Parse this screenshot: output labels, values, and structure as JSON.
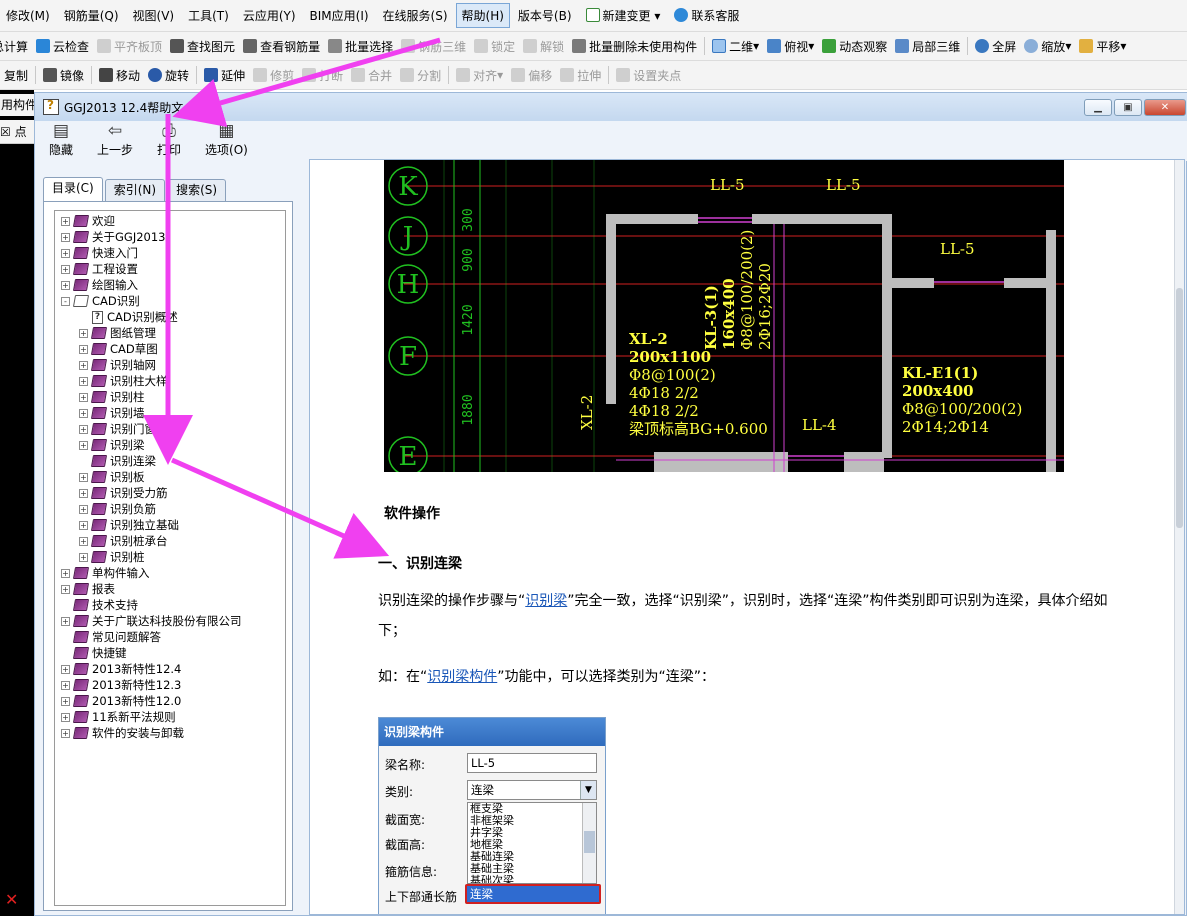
{
  "menubar": {
    "items": [
      "修改(M)",
      "钢筋量(Q)",
      "视图(V)",
      "工具(T)",
      "云应用(Y)",
      "BIM应用(I)",
      "在线服务(S)",
      "帮助(H)",
      "版本号(B)",
      "新建变更",
      "联系客服"
    ]
  },
  "toolbar1": {
    "items": [
      "总计算",
      "云检查",
      "平齐板顶",
      "查找图元",
      "查看钢筋量",
      "批量选择",
      "钢筋三维",
      "锁定",
      "解锁",
      "批量删除未使用构件",
      "二维",
      "俯视",
      "动态观察",
      "局部三维",
      "全屏",
      "缩放",
      "平移"
    ]
  },
  "toolbar2": {
    "items": [
      "复制",
      "镜像",
      "移动",
      "旋转",
      "延伸",
      "修剪",
      "打断",
      "合并",
      "分割",
      "对齐",
      "偏移",
      "拉伸",
      "设置夹点"
    ]
  },
  "left_strip": {
    "label1": "用构件",
    "label2": "☒ 点"
  },
  "help_window": {
    "title": "GGJ2013 12.4帮助文",
    "toolbar": [
      "隐藏",
      "上一步",
      "打印",
      "选项(O)"
    ],
    "nav_tabs": [
      "目录(C)",
      "索引(N)",
      "搜索(S)"
    ],
    "tree": [
      {
        "label": "欢迎",
        "level": 0,
        "icon": "book",
        "expander": "+"
      },
      {
        "label": "关于GGJ2013",
        "level": 0,
        "icon": "book",
        "expander": "+"
      },
      {
        "label": "快速入门",
        "level": 0,
        "icon": "book",
        "expander": "+"
      },
      {
        "label": "工程设置",
        "level": 0,
        "icon": "book",
        "expander": "+"
      },
      {
        "label": "绘图输入",
        "level": 0,
        "icon": "book",
        "expander": "+"
      },
      {
        "label": "CAD识别",
        "level": 0,
        "icon": "book-open",
        "expander": "-"
      },
      {
        "label": "CAD识别概述",
        "level": 1,
        "icon": "page",
        "expander": ""
      },
      {
        "label": "图纸管理",
        "level": 1,
        "icon": "book",
        "expander": "+"
      },
      {
        "label": "CAD草图",
        "level": 1,
        "icon": "book",
        "expander": "+"
      },
      {
        "label": "识别轴网",
        "level": 1,
        "icon": "book",
        "expander": "+"
      },
      {
        "label": "识别柱大样",
        "level": 1,
        "icon": "book",
        "expander": "+"
      },
      {
        "label": "识别柱",
        "level": 1,
        "icon": "book",
        "expander": "+"
      },
      {
        "label": "识别墙",
        "level": 1,
        "icon": "book",
        "expander": "+"
      },
      {
        "label": "识别门窗洞",
        "level": 1,
        "icon": "book",
        "expander": "+"
      },
      {
        "label": "识别梁",
        "level": 1,
        "icon": "book",
        "expander": "+"
      },
      {
        "label": "识别连梁",
        "level": 1,
        "icon": "book",
        "expander": ""
      },
      {
        "label": "识别板",
        "level": 1,
        "icon": "book",
        "expander": "+"
      },
      {
        "label": "识别受力筋",
        "level": 1,
        "icon": "book",
        "expander": "+"
      },
      {
        "label": "识别负筋",
        "level": 1,
        "icon": "book",
        "expander": "+"
      },
      {
        "label": "识别独立基础",
        "level": 1,
        "icon": "book",
        "expander": "+"
      },
      {
        "label": "识别桩承台",
        "level": 1,
        "icon": "book",
        "expander": "+"
      },
      {
        "label": "识别桩",
        "level": 1,
        "icon": "book",
        "expander": "+"
      },
      {
        "label": "单构件输入",
        "level": 0,
        "icon": "book",
        "expander": "+"
      },
      {
        "label": "报表",
        "level": 0,
        "icon": "book",
        "expander": "+"
      },
      {
        "label": "技术支持",
        "level": 0,
        "icon": "book",
        "expander": ""
      },
      {
        "label": "关于广联达科技股份有限公司",
        "level": 0,
        "icon": "book",
        "expander": "+"
      },
      {
        "label": "常见问题解答",
        "level": 0,
        "icon": "book",
        "expander": ""
      },
      {
        "label": "快捷键",
        "level": 0,
        "icon": "book",
        "expander": ""
      },
      {
        "label": "2013新特性12.4",
        "level": 0,
        "icon": "book",
        "expander": "+"
      },
      {
        "label": "2013新特性12.3",
        "level": 0,
        "icon": "book",
        "expander": "+"
      },
      {
        "label": "2013新特性12.0",
        "level": 0,
        "icon": "book",
        "expander": "+"
      },
      {
        "label": "11系新平法规则",
        "level": 0,
        "icon": "book",
        "expander": "+"
      },
      {
        "label": "软件的安装与卸载",
        "level": 0,
        "icon": "book",
        "expander": "+"
      }
    ],
    "content": {
      "cad": {
        "axis_labels": [
          "K",
          "J",
          "H",
          "F",
          "E"
        ],
        "dims": [
          "300",
          "900",
          "1420",
          "1880"
        ],
        "labels": [
          "LL-5",
          "LL-5",
          "LL-5",
          "LL-4",
          "XL-2"
        ],
        "xl2_block": [
          "XL-2",
          "200x1100",
          "Φ8@100(2)",
          "4Φ18 2/2",
          "4Φ18 2/2",
          "梁顶标高BG+0.600"
        ],
        "kl3_block": [
          "KL-3(1)",
          "160x400",
          "Φ8@100/200(2)",
          "2Φ16;2Φ20"
        ],
        "kle1_block": [
          "KL-E1(1)",
          "200x400",
          "Φ8@100/200(2)",
          "2Φ14;2Φ14"
        ]
      },
      "heading_main": "软件操作",
      "heading_sub": "一、识别连梁",
      "para1_a": "识别连梁的操作步骤与“",
      "para1_link": "识别梁",
      "para1_b": "”完全一致，选择“识别梁”，识别时，选择“连梁”构件类别即可识别为连梁，具体介绍如下；",
      "para2_a": "如：在“",
      "para2_link": "识别梁构件",
      "para2_b": "”功能中，可以选择类别为“连梁”：",
      "dialog": {
        "title": "识别梁构件",
        "name_label": "梁名称:",
        "name_value": "LL-5",
        "category_label": "类别:",
        "category_value": "连梁",
        "width_label": "截面宽:",
        "height_label": "截面高:",
        "stirrup_label": "箍筋信息:",
        "longbar_label": "上下部通长筋",
        "options": [
          "框支梁",
          "非框架梁",
          "井字梁",
          "地框梁",
          "基础连梁",
          "基础主梁",
          "基础次梁"
        ],
        "selected": "连梁"
      }
    }
  }
}
